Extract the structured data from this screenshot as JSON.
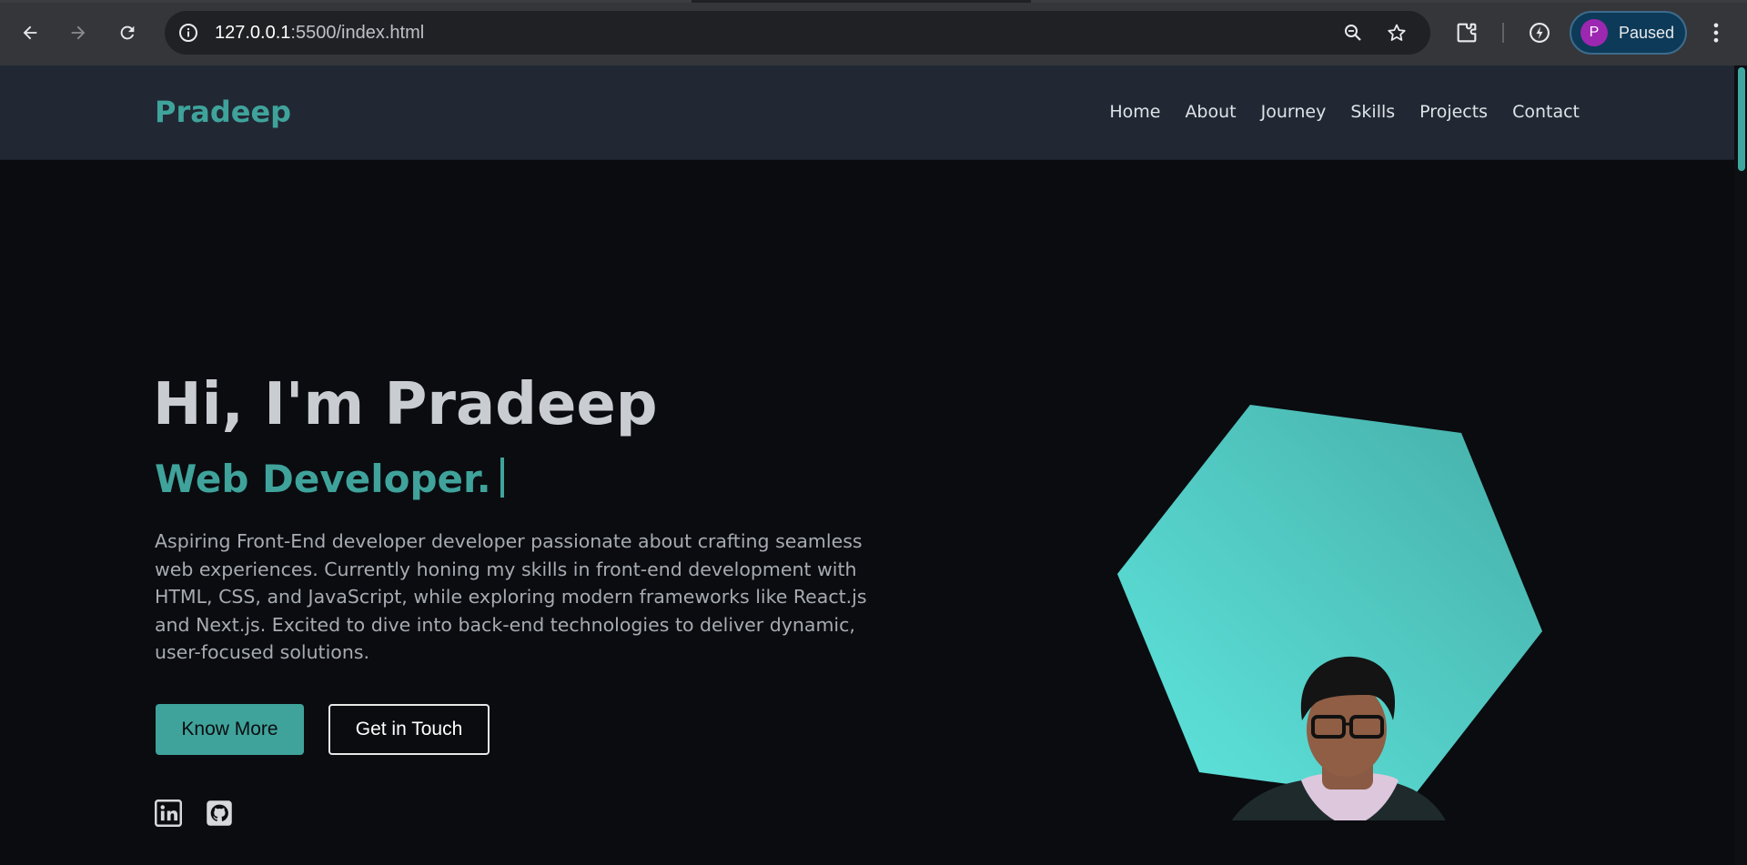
{
  "browser": {
    "url_host": "127.0.0.1",
    "url_path": ":5500/index.html",
    "profile_initial": "P",
    "profile_status": "Paused",
    "icons": [
      "back-icon",
      "forward-icon",
      "reload-icon",
      "info-icon",
      "zoom-icon",
      "star-icon",
      "extensions-icon",
      "performance-icon",
      "menu-kebab-icon"
    ]
  },
  "site": {
    "brand": "Pradeep",
    "nav": [
      "Home",
      "About",
      "Journey",
      "Skills",
      "Projects",
      "Contact"
    ]
  },
  "hero": {
    "title": "Hi, I'm Pradeep",
    "subtitle": "Web Developer.",
    "description": "Aspiring Front-End developer developer passionate about crafting seamless web experiences. Currently honing my skills in front-end development with HTML, CSS, and JavaScript, while exploring modern frameworks like React.js and Next.js. Excited to dive into back-end technologies to deliver dynamic, user-focused solutions.",
    "primary_button": "Know More",
    "secondary_button": "Get in Touch",
    "social": [
      "linkedin-icon",
      "github-icon"
    ]
  },
  "colors": {
    "accent": "#3fa39b",
    "header_bg": "#212833",
    "page_bg": "#0a0c10",
    "hex_light": "#5ee6de",
    "hex_dark": "#46aea8"
  }
}
